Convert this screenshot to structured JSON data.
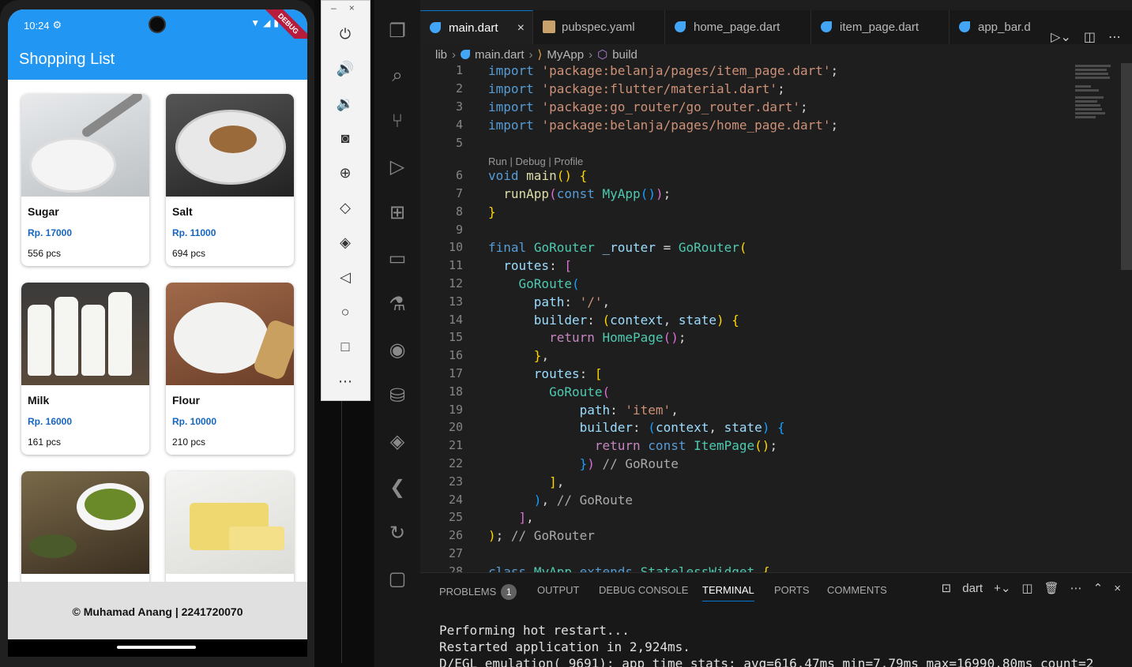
{
  "phone": {
    "status_time": "10:24",
    "debug_label": "DEBUG",
    "app_title": "Shopping List",
    "items": [
      {
        "name": "Sugar",
        "price": "Rp. 17000",
        "stock": "556 pcs",
        "color": "#cfd3d6"
      },
      {
        "name": "Salt",
        "price": "Rp. 11000",
        "stock": "694 pcs",
        "color": "#9a9ea0"
      },
      {
        "name": "Milk",
        "price": "Rp. 16000",
        "stock": "161 pcs",
        "color": "#6b5a4a"
      },
      {
        "name": "Flour",
        "price": "Rp. 10000",
        "stock": "210 pcs",
        "color": "#8b5a3c"
      },
      {
        "name": "",
        "price": "",
        "stock": "",
        "color": "#5a6b3a"
      },
      {
        "name": "",
        "price": "",
        "stock": "",
        "color": "#e9d98a"
      }
    ],
    "footer": "© Muhamad Anang | 2241720070"
  },
  "emulator": {
    "minimize": "–",
    "close": "×"
  },
  "vscode": {
    "tabs": [
      {
        "label": "main.dart",
        "icon": "dart-icon"
      },
      {
        "label": "pubspec.yaml",
        "icon": "yaml-icon"
      },
      {
        "label": "home_page.dart",
        "icon": "dart-icon"
      },
      {
        "label": "item_page.dart",
        "icon": "dart-icon"
      },
      {
        "label": "app_bar.d",
        "icon": "dart-icon"
      }
    ],
    "breadcrumb": [
      "lib",
      "main.dart",
      "MyApp",
      "build"
    ],
    "codelens": "Run | Debug | Profile",
    "panel_tabs": [
      "PROBLEMS",
      "OUTPUT",
      "DEBUG CONSOLE",
      "TERMINAL",
      "PORTS",
      "COMMENTS"
    ],
    "problems_count": "1",
    "terminal_label": "dart",
    "terminal_lines": [
      "Performing hot restart...",
      "Restarted application in 2,924ms.",
      "D/EGL_emulation( 9691): app_time_stats: avg=616.47ms min=7.79ms max=16990.80ms count=2"
    ]
  }
}
